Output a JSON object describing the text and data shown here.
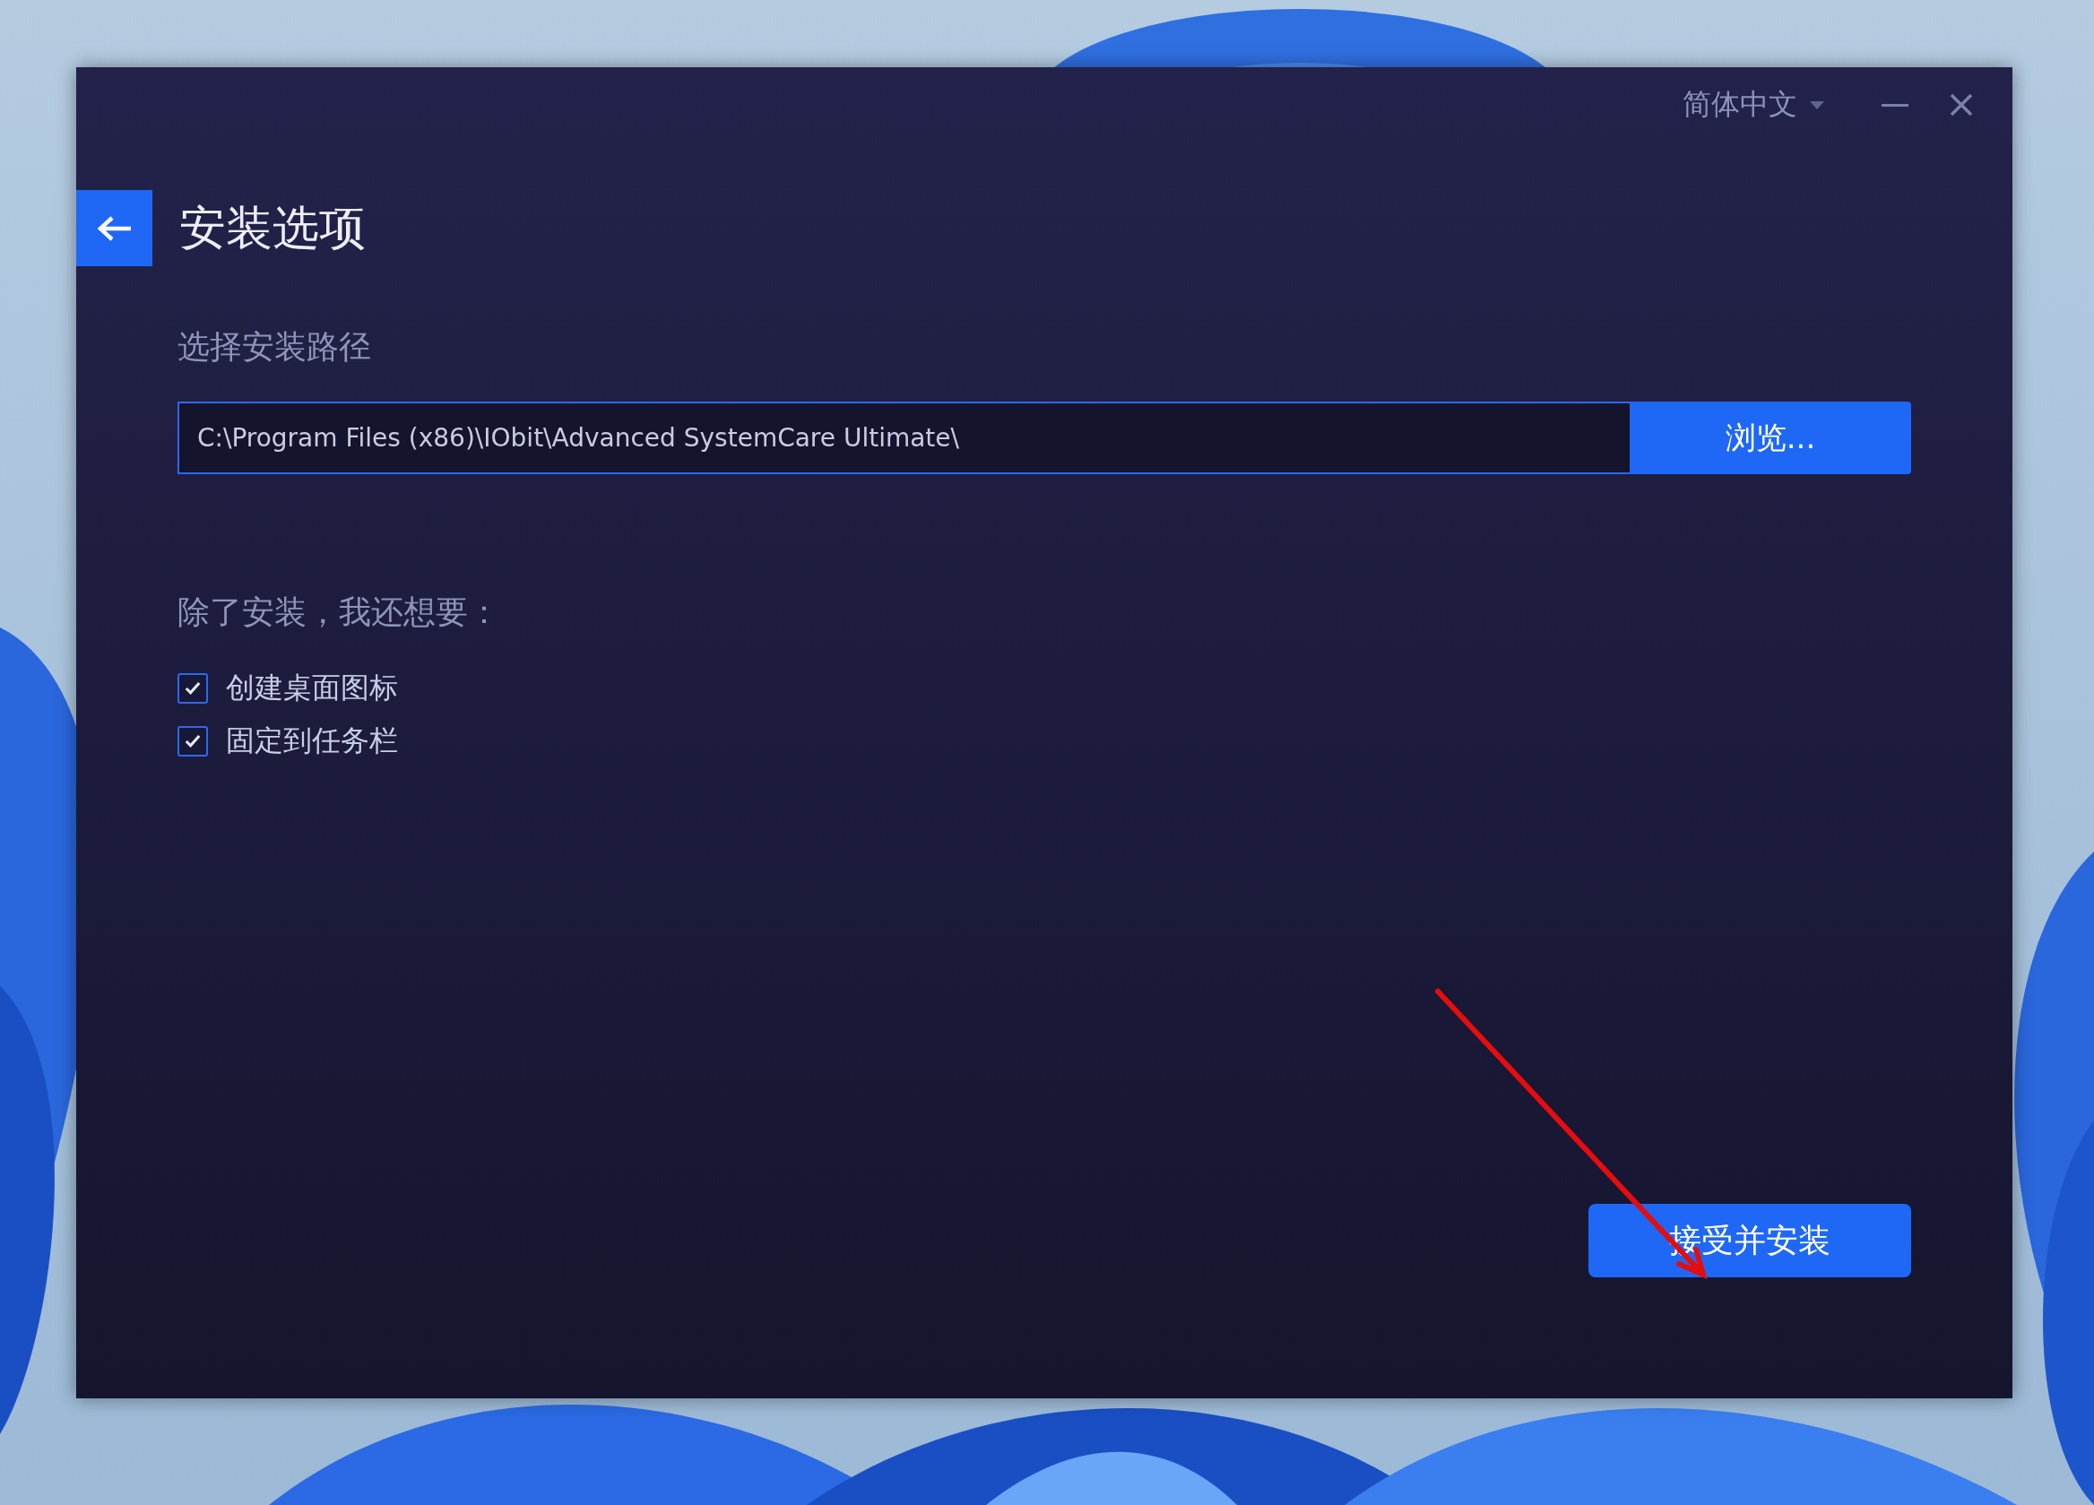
{
  "window": {
    "language": "简体中文",
    "title": "安装选项"
  },
  "install_path": {
    "label": "选择安装路径",
    "value": "C:\\Program Files (x86)\\IObit\\Advanced SystemCare Ultimate\\",
    "browse_button": "浏览..."
  },
  "extras": {
    "label": "除了安装，我还想要：",
    "options": [
      {
        "label": "创建桌面图标",
        "checked": true
      },
      {
        "label": "固定到任务栏",
        "checked": true
      }
    ]
  },
  "install_button": "接受并安装"
}
